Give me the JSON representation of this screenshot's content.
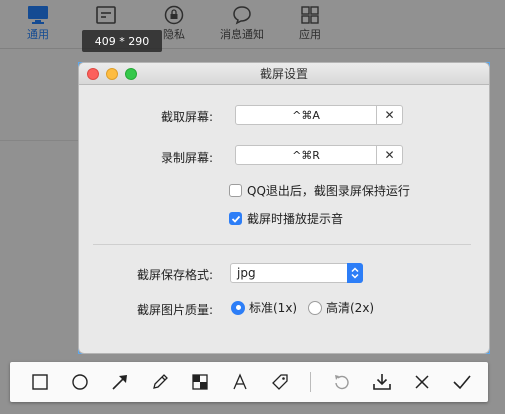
{
  "background_app": {
    "tabs": [
      {
        "label": "通用",
        "icon": "monitor-icon",
        "active": true
      },
      {
        "label": "",
        "icon": "panel-icon",
        "active": false
      },
      {
        "label": "隐私",
        "icon": "lock-icon",
        "active": false
      },
      {
        "label": "消息通知",
        "icon": "chat-bubble-icon",
        "active": false
      },
      {
        "label": "应用",
        "icon": "grid-icon",
        "active": false
      }
    ]
  },
  "size_indicator": "409 * 290",
  "dialog": {
    "title": "截屏设置",
    "capture_label": "截取屏幕:",
    "capture_shortcut": "^⌘A",
    "record_label": "录制屏幕:",
    "record_shortcut": "^⌘R",
    "clear_symbol": "✕",
    "option_keep_running": {
      "label": "QQ退出后，截图录屏保持运行",
      "checked": false
    },
    "option_play_sound": {
      "label": "截屏时播放提示音",
      "checked": true
    },
    "format_label": "截屏保存格式:",
    "format_value": "jpg",
    "quality_label": "截屏图片质量:",
    "quality_options": [
      {
        "label": "标准(1x)",
        "selected": true
      },
      {
        "label": "高清(2x)",
        "selected": false
      }
    ]
  },
  "toolbar": {
    "tools": [
      "rectangle-icon",
      "ellipse-icon",
      "arrow-icon",
      "pen-icon",
      "mosaic-icon",
      "text-icon",
      "tag-icon",
      "undo-icon",
      "download-icon",
      "cancel-icon",
      "confirm-icon"
    ]
  },
  "colors": {
    "accent": "#2d7ef7",
    "capture_border": "#5aa8f0",
    "active_tab": "#1e6fd9"
  }
}
